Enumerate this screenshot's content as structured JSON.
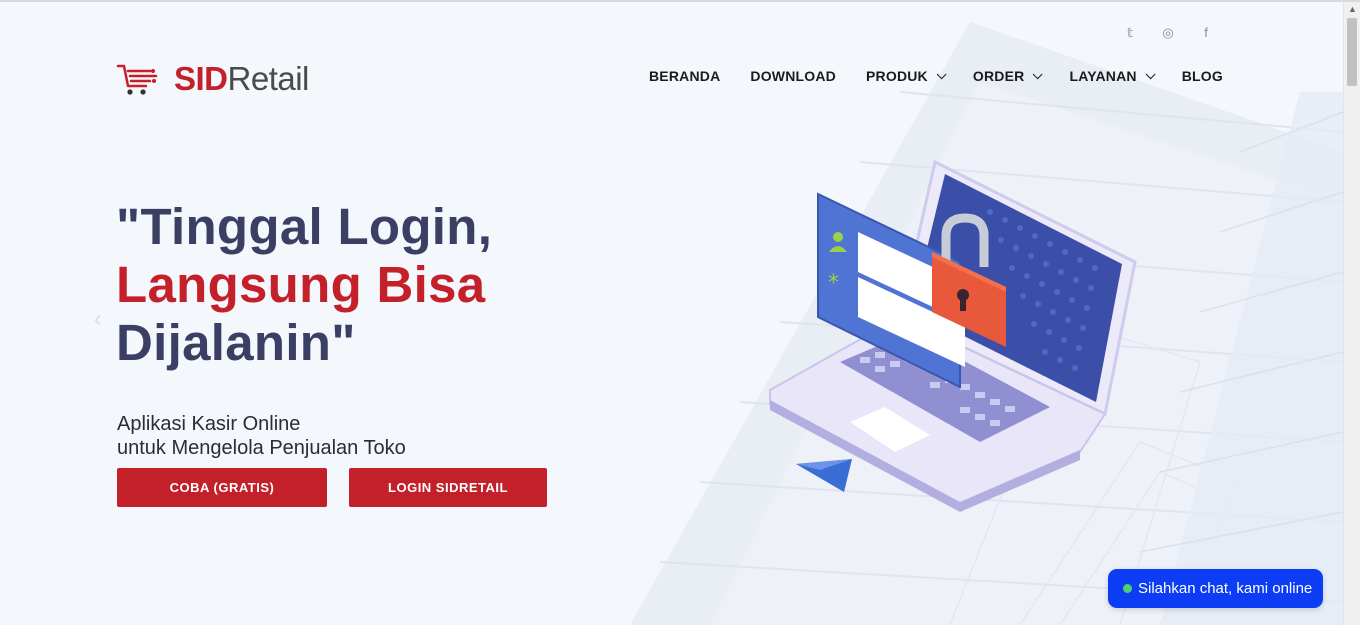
{
  "brand": {
    "logo_bold": "SID",
    "logo_regular": "Retail",
    "accent_color": "#c4202a",
    "title_color": "#3b3f63"
  },
  "social": [
    {
      "icon": "twitter-icon",
      "glyph": "𝕥"
    },
    {
      "icon": "instagram-icon",
      "glyph": "◎"
    },
    {
      "icon": "facebook-icon",
      "glyph": "f"
    }
  ],
  "nav": {
    "items": [
      {
        "label": "BERANDA",
        "dropdown": false
      },
      {
        "label": "DOWNLOAD",
        "dropdown": false
      },
      {
        "label": "PRODUK",
        "dropdown": true
      },
      {
        "label": "ORDER",
        "dropdown": true
      },
      {
        "label": "LAYANAN",
        "dropdown": true
      },
      {
        "label": "BLOG",
        "dropdown": false
      }
    ]
  },
  "hero": {
    "title_line1": "\"Tinggal Login,",
    "title_line2": "Langsung Bisa",
    "title_line3": "Dijalanin\"",
    "subtitle_line1": "Aplikasi Kasir Online",
    "subtitle_line2": "untuk Mengelola Penjualan Toko",
    "button_primary": "COBA (GRATIS)",
    "button_secondary": "LOGIN SIDRETAIL"
  },
  "chat": {
    "label": "Silahkan chat, kami online",
    "color": "#0c3df5",
    "status_color": "#49d36c"
  }
}
